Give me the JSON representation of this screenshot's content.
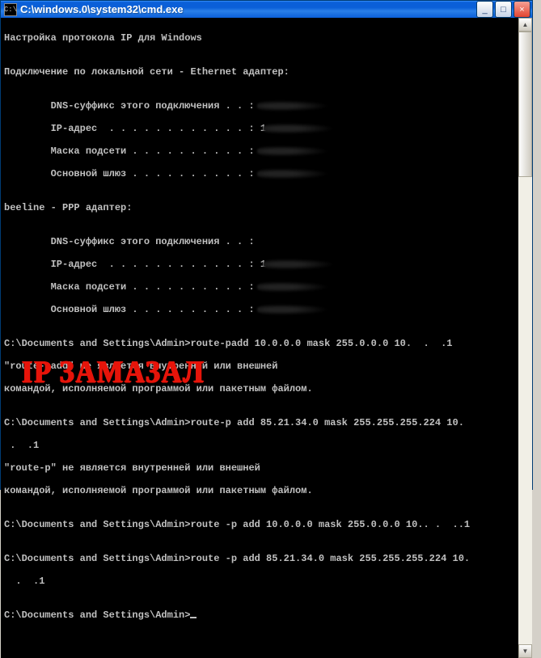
{
  "window": {
    "title": "C:\\windows.0\\system32\\cmd.exe",
    "icon_label": "C:\\"
  },
  "controls": {
    "minimize": "_",
    "maximize": "□",
    "close": "×"
  },
  "console": {
    "l01": "Настройка протокола IP для Windows",
    "l02": "",
    "l03": "Подключение по локальной сети - Ethernet адаптер:",
    "l04": "",
    "l05": "        DNS-суффикс этого подключения . . :",
    "l06": "        IP-адрес  . . . . . . . . . . . . :",
    "l07": "        Маска подсети . . . . . . . . . . :",
    "l08": "        Основной шлюз . . . . . . . . . . :",
    "l09": "",
    "l10": "beeline - PPP адаптер:",
    "l11": "",
    "l12": "        DNS-суффикс этого подключения . . :",
    "l13": "        IP-адрес  . . . . . . . . . . . . :",
    "l14": "        Маска подсети . . . . . . . . . . :",
    "l15": "        Основной шлюз . . . . . . . . . . :",
    "l16": "",
    "l17a": "C:\\Documents and Settings\\Admin>",
    "l17b": "route-padd 10.0.0.0 mask 255.0.0.0 10.  .  .1",
    "l18": "\"route-padd\" не является внутренней или внешней",
    "l19": "командой, исполняемой программой или пакетным файлом.",
    "l20": "",
    "l21a": "C:\\Documents and Settings\\Admin>",
    "l21b": "route-p add 85.21.34.0 mask 255.255.255.224 10. ",
    "l22": " .  .1",
    "l23": "\"route-p\" не является внутренней или внешней",
    "l24": "командой, исполняемой программой или пакетным файлом.",
    "l25": "",
    "l26a": "C:\\Documents and Settings\\Admin>",
    "l26b": "route -p add 10.0.0.0 mask 255.0.0.0 10.. .  ..1",
    "l27": "",
    "l28a": "C:\\Documents and Settings\\Admin>",
    "l28b": "route -p add 85.21.34.0 mask 255.255.255.224 10.",
    "l29": "  .  .1",
    "l30": "",
    "l31": "C:\\Documents and Settings\\Admin>"
  },
  "annotation": {
    "text": "IP ЗАМАЗАЛ"
  },
  "scrollbar": {
    "up": "▲",
    "down": "▼"
  }
}
